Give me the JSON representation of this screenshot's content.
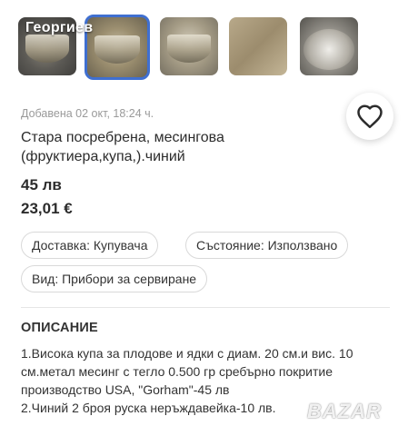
{
  "gallery": {
    "seller_name": "Георгиев",
    "thumbnails": [
      "photo-1",
      "photo-2",
      "photo-3",
      "photo-4",
      "photo-5"
    ],
    "selected_index": 1,
    "selected_border_color": "#3f6fd0"
  },
  "listing": {
    "added": "Добавена 02 окт, 18:24 ч.",
    "title": "Стара посребрена, месингова (фруктиера,купа,).чиний",
    "price_bgn": "45 лв",
    "price_eur": "23,01 €",
    "favorite_icon": "heart-outline-icon"
  },
  "attributes": [
    {
      "label": "Доставка: Купувача"
    },
    {
      "label": "Състояние: Използвано"
    },
    {
      "label": "Вид: Прибори за сервиране"
    }
  ],
  "description": {
    "heading": "ОПИСАНИЕ",
    "lines": [
      "1.Висока купа за плодове и ядки с диам. 20 см.и вис. 10 см.метал месинг с тегло 0.500 гр сребърно покритие производство USA, \"Gorham\"-45 лв",
      "2.Чиний 2 броя руска неръждавейка-10 лв."
    ]
  },
  "watermark": "BAZAR"
}
